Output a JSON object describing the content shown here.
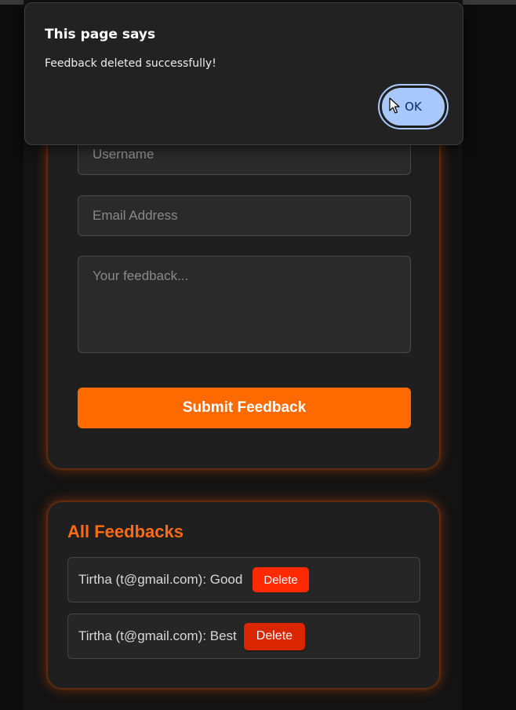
{
  "form": {
    "username_placeholder": "Username",
    "email_placeholder": "Email Address",
    "feedback_placeholder": "Your feedback...",
    "submit_label": "Submit Feedback"
  },
  "feedbacks": {
    "title": "All Feedbacks",
    "items": [
      {
        "text": "Tirtha (t@gmail.com): Good",
        "delete_label": "Delete"
      },
      {
        "text": "Tirtha (t@gmail.com): Best",
        "delete_label": "Delete"
      }
    ]
  },
  "dialog": {
    "title": "This page says",
    "message": "Feedback deleted successfully!",
    "ok_label": "OK"
  },
  "colors": {
    "accent": "#ff6a00",
    "delete": "#ff2a00",
    "dialog_button": "#a8c7fa",
    "card": "#1f1f1f"
  },
  "icons": {
    "cursor": "mouse-pointer-icon"
  }
}
